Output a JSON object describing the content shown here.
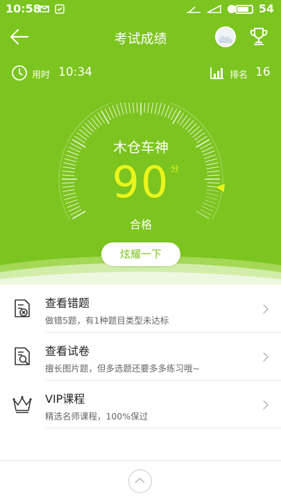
{
  "status_bar": {
    "time": "10:58",
    "battery": "54"
  },
  "nav": {
    "title": "考试成绩",
    "back_icon": "arrow-left-icon",
    "trophy_icon": "trophy-icon"
  },
  "stats": {
    "time_label": "用时",
    "time_value": "10:34",
    "rank_label": "排名",
    "rank_value": "16"
  },
  "result": {
    "title": "木仓车神",
    "score": "90",
    "score_unit": "分",
    "pass_text": "合格",
    "score_fraction": 0.9
  },
  "share_button": "炫耀一下",
  "menu": [
    {
      "title": "查看错题",
      "subtitle": "做错5题，有1种题目类型未达标",
      "icon": "wrong-answers-icon"
    },
    {
      "title": "查看试卷",
      "subtitle": "擅长图片题，但多选题还要多多练习哦~",
      "icon": "exam-paper-search-icon"
    },
    {
      "title": "VIP课程",
      "subtitle": "精选名师课程，100%保过",
      "icon": "crown-icon"
    }
  ],
  "colors": {
    "primary_green": "#7cc41f",
    "score_yellow": "#e9f51b",
    "text_dark": "#222222",
    "text_gray": "#666666"
  }
}
